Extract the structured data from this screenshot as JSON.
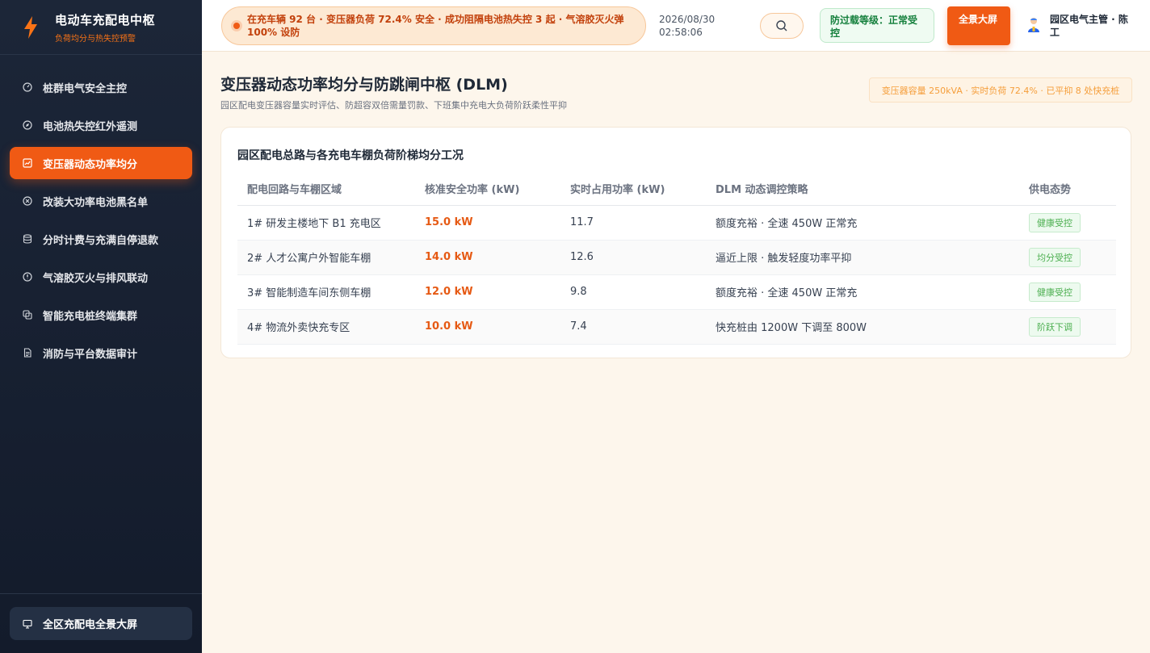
{
  "brand": {
    "title": "电动车充配电中枢",
    "subtitle": "负荷均分与热失控预警"
  },
  "sidebar": {
    "items": [
      {
        "label": "桩群电气安全主控",
        "icon": "gauge-icon",
        "active": false
      },
      {
        "label": "电池热失控红外遥测",
        "icon": "compass-icon",
        "active": false
      },
      {
        "label": "变压器动态功率均分",
        "icon": "chart-icon",
        "active": true
      },
      {
        "label": "改装大功率电池黑名单",
        "icon": "x-circle-icon",
        "active": false
      },
      {
        "label": "分时计费与充满自停退款",
        "icon": "database-icon",
        "active": false
      },
      {
        "label": "气溶胶灭火与排风联动",
        "icon": "info-circle-icon",
        "active": false
      },
      {
        "label": "智能充电桩终端集群",
        "icon": "layers-icon",
        "active": false
      },
      {
        "label": "消防与平台数据审计",
        "icon": "document-icon",
        "active": false
      }
    ],
    "footer_label": "全区充配电全景大屏"
  },
  "header": {
    "alert_text": "在充车辆 92 台 · 变压器负荷 72.4% 安全 · 成功阻隔电池热失控 3 起 · 气溶胶灭火弹 100% 设防",
    "date": "2026/08/30",
    "time": "02:58:06",
    "level_badge": "防过载等级：正常受控",
    "fullscreen_label": "全景大屏",
    "user_name": "园区电气主管 · 陈工"
  },
  "main": {
    "title": "变压器动态功率均分与防跳闸中枢 (DLM)",
    "subtitle": "园区配电变压器容量实时评估、防超容双倍需量罚款、下班集中充电大负荷阶跃柔性平抑",
    "capacity_badge": "变压器容量 250kVA · 实时负荷 72.4% · 已平抑 8 处快充桩",
    "card": {
      "title": "园区配电总路与各充电车棚负荷阶梯均分工况",
      "columns": [
        "配电回路与车棚区域",
        "核准安全功率 (kW)",
        "实时占用功率 (kW)",
        "DLM 动态调控策略",
        "供电态势"
      ],
      "rows": [
        {
          "area": "1# 研发主楼地下 B1 充电区",
          "safe": "15.0 kW",
          "actual": "11.7",
          "strategy": "额度充裕 · 全速 450W 正常充",
          "status": "健康受控"
        },
        {
          "area": "2# 人才公寓户外智能车棚",
          "safe": "14.0 kW",
          "actual": "12.6",
          "strategy": "逼近上限 · 触发轻度功率平抑",
          "status": "均分受控"
        },
        {
          "area": "3# 智能制造车间东侧车棚",
          "safe": "12.0 kW",
          "actual": "9.8",
          "strategy": "额度充裕 · 全速 450W 正常充",
          "status": "健康受控"
        },
        {
          "area": "4# 物流外卖快充专区",
          "safe": "10.0 kW",
          "actual": "7.4",
          "strategy": "快充桩由 1200W 下调至 800W",
          "status": "阶跃下调"
        }
      ]
    }
  },
  "colors": {
    "accent": "#f05a14",
    "sidebar_bg": "#1c2638",
    "status_green": "#4caf50"
  }
}
